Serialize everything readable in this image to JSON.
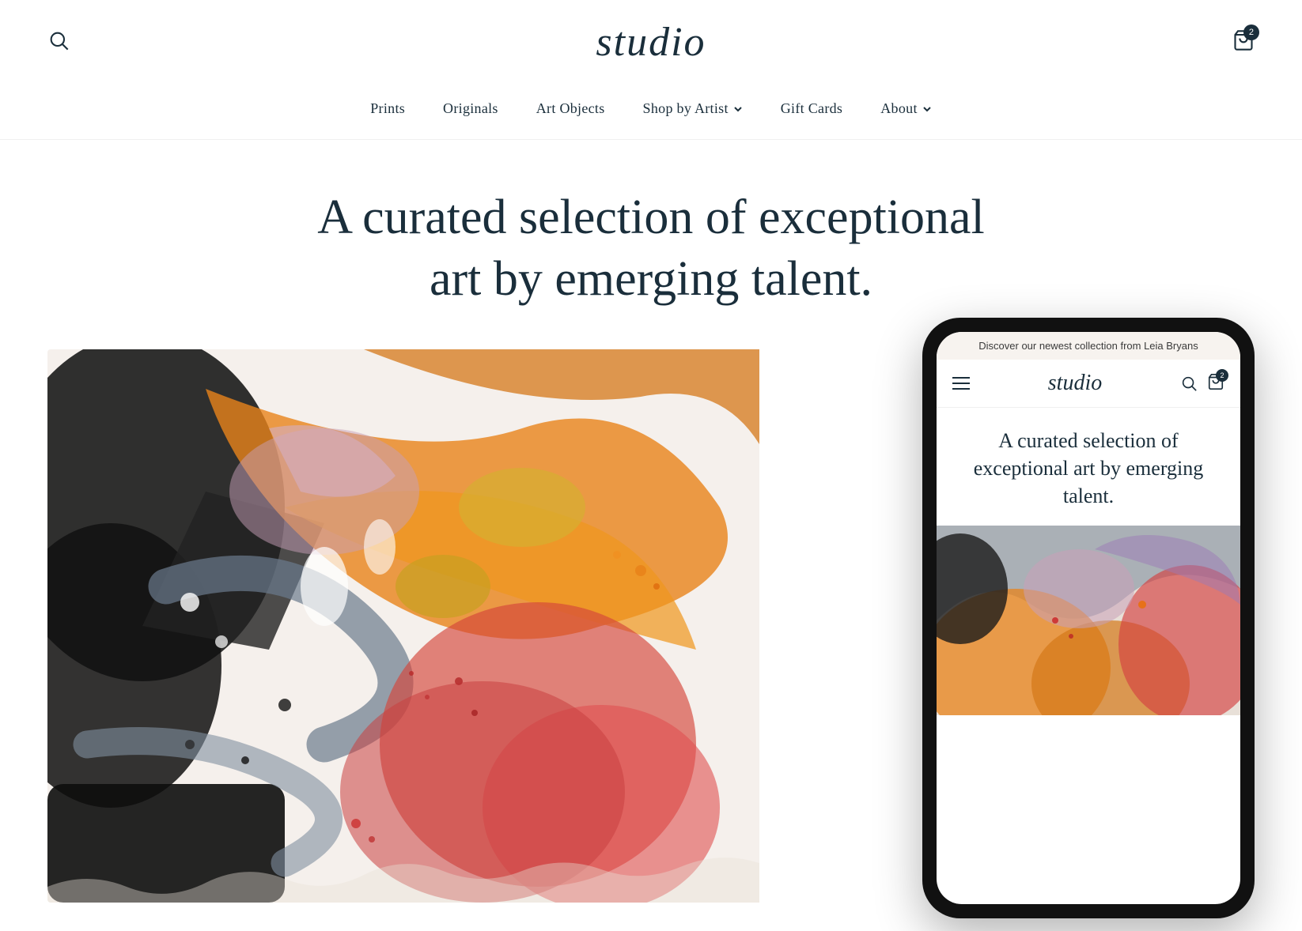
{
  "site": {
    "logo": "studio",
    "cart_count": "2"
  },
  "header": {
    "search_label": "search",
    "cart_label": "cart"
  },
  "nav": {
    "items": [
      {
        "id": "prints",
        "label": "Prints",
        "has_dropdown": false
      },
      {
        "id": "originals",
        "label": "Originals",
        "has_dropdown": false
      },
      {
        "id": "art-objects",
        "label": "Art Objects",
        "has_dropdown": false
      },
      {
        "id": "shop-by-artist",
        "label": "Shop by Artist",
        "has_dropdown": true
      },
      {
        "id": "gift-cards",
        "label": "Gift Cards",
        "has_dropdown": false
      },
      {
        "id": "about",
        "label": "About",
        "has_dropdown": true
      }
    ]
  },
  "hero": {
    "headline": "A curated selection of exceptional art by emerging talent."
  },
  "phone": {
    "announce_bar": "Discover our newest collection from Leia Bryans",
    "headline": "A curated selection of exceptional art by emerging talent.",
    "cart_count": "2"
  }
}
